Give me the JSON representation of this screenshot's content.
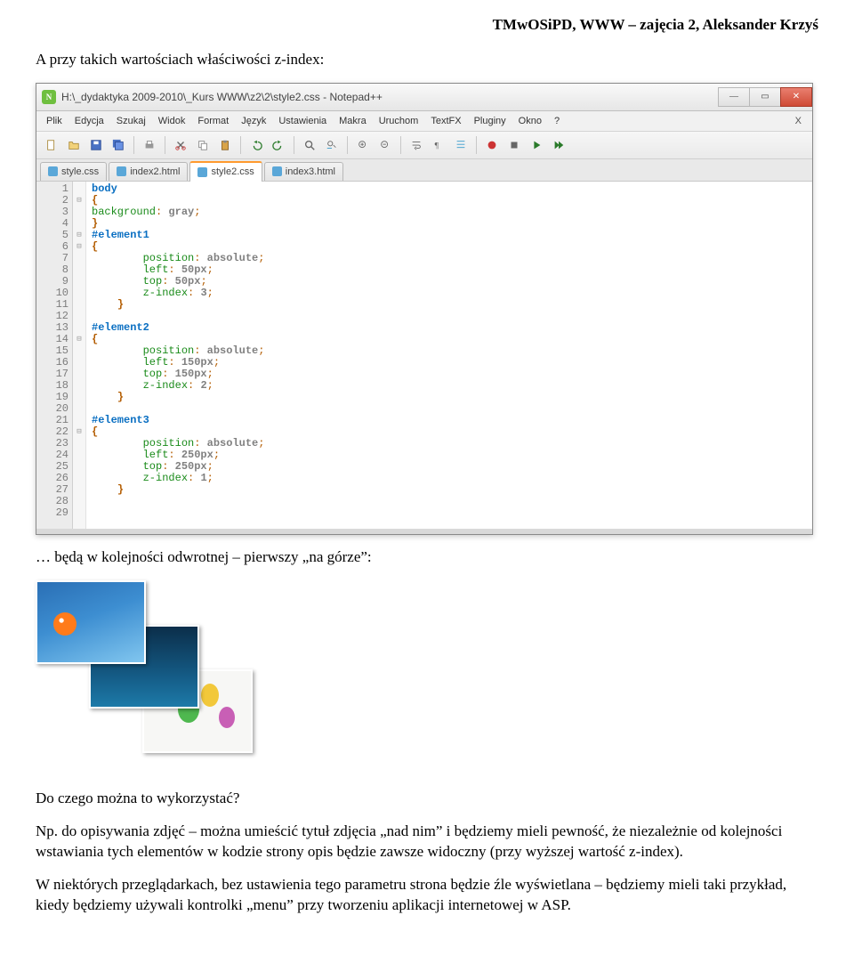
{
  "doc": {
    "header": "TMwOSiPD, WWW – zajęcia 2, Aleksander Krzyś",
    "intro": "A przy takich wartościach właściwości z-index:",
    "after_editor": "… będą w kolejności odwrotnej – pierwszy „na górze”:",
    "q": "Do czego można to wykorzystać?",
    "p1": "Np. do opisywania zdjęć – można umieścić tytuł zdjęcia „nad nim” i będziemy mieli pewność, że niezależnie od kolejności wstawiania tych elementów w kodzie strony opis będzie zawsze widoczny (przy wyższej wartość z-index).",
    "p2": "W niektórych przeglądarkach, bez ustawienia tego parametru strona będzie źle wyświetlana – będziemy mieli taki przykład, kiedy będziemy używali kontrolki „menu” przy tworzeniu aplikacji internetowej w ASP."
  },
  "win": {
    "title": "H:\\_dydaktyka 2009-2010\\_Kurs WWW\\z2\\2\\style2.css - Notepad++"
  },
  "menu": {
    "items": [
      "Plik",
      "Edycja",
      "Szukaj",
      "Widok",
      "Format",
      "Język",
      "Ustawienia",
      "Makra",
      "Uruchom",
      "TextFX",
      "Pluginy",
      "Okno",
      "?"
    ]
  },
  "tabs": [
    {
      "label": "style.css",
      "active": false
    },
    {
      "label": "index2.html",
      "active": false
    },
    {
      "label": "style2.css",
      "active": true
    },
    {
      "label": "index3.html",
      "active": false
    }
  ],
  "lines": [
    "1",
    "2",
    "3",
    "4",
    "5",
    "6",
    "7",
    "8",
    "9",
    "10",
    "11",
    "12",
    "13",
    "14",
    "15",
    "16",
    "17",
    "18",
    "19",
    "20",
    "21",
    "22",
    "23",
    "24",
    "25",
    "26",
    "27",
    "28",
    "29"
  ],
  "fold": [
    "",
    "⊟",
    "",
    "",
    "⊟",
    "⊟",
    "",
    "",
    "",
    "",
    "",
    "",
    "",
    "⊟",
    "",
    "",
    "",
    "",
    "",
    "",
    "",
    "⊟",
    "",
    "",
    "",
    "",
    "",
    "",
    ""
  ],
  "code": [
    {
      "t": "sel",
      "txt": "body"
    },
    {
      "t": "br",
      "txt": "{"
    },
    {
      "t": "line",
      "parts": [
        {
          "t": "prop",
          "txt": "background"
        },
        {
          "t": "op",
          "txt": ": "
        },
        {
          "t": "val",
          "txt": "gray"
        },
        {
          "t": "op",
          "txt": ";"
        }
      ]
    },
    {
      "t": "br",
      "txt": "}"
    },
    {
      "t": "sel",
      "txt": "#element1"
    },
    {
      "t": "br",
      "txt": "{"
    },
    {
      "t": "line",
      "indent": 2,
      "parts": [
        {
          "t": "prop",
          "txt": "position"
        },
        {
          "t": "op",
          "txt": ": "
        },
        {
          "t": "val",
          "txt": "absolute"
        },
        {
          "t": "op",
          "txt": ";"
        }
      ]
    },
    {
      "t": "line",
      "indent": 2,
      "parts": [
        {
          "t": "prop",
          "txt": "left"
        },
        {
          "t": "op",
          "txt": ": "
        },
        {
          "t": "val",
          "txt": "50px"
        },
        {
          "t": "op",
          "txt": ";"
        }
      ]
    },
    {
      "t": "line",
      "indent": 2,
      "parts": [
        {
          "t": "prop",
          "txt": "top"
        },
        {
          "t": "op",
          "txt": ": "
        },
        {
          "t": "val",
          "txt": "50px"
        },
        {
          "t": "op",
          "txt": ";"
        }
      ]
    },
    {
      "t": "line",
      "indent": 2,
      "parts": [
        {
          "t": "prop",
          "txt": "z-index"
        },
        {
          "t": "op",
          "txt": ": "
        },
        {
          "t": "val",
          "txt": "3"
        },
        {
          "t": "op",
          "txt": ";"
        }
      ]
    },
    {
      "t": "br",
      "indent": 1,
      "txt": "}"
    },
    {
      "t": "blank"
    },
    {
      "t": "sel",
      "txt": "#element2"
    },
    {
      "t": "br",
      "txt": "{"
    },
    {
      "t": "line",
      "indent": 2,
      "parts": [
        {
          "t": "prop",
          "txt": "position"
        },
        {
          "t": "op",
          "txt": ": "
        },
        {
          "t": "val",
          "txt": "absolute"
        },
        {
          "t": "op",
          "txt": ";"
        }
      ]
    },
    {
      "t": "line",
      "indent": 2,
      "parts": [
        {
          "t": "prop",
          "txt": "left"
        },
        {
          "t": "op",
          "txt": ": "
        },
        {
          "t": "val",
          "txt": "150px"
        },
        {
          "t": "op",
          "txt": ";"
        }
      ]
    },
    {
      "t": "line",
      "indent": 2,
      "parts": [
        {
          "t": "prop",
          "txt": "top"
        },
        {
          "t": "op",
          "txt": ": "
        },
        {
          "t": "val",
          "txt": "150px"
        },
        {
          "t": "op",
          "txt": ";"
        }
      ]
    },
    {
      "t": "line",
      "indent": 2,
      "parts": [
        {
          "t": "prop",
          "txt": "z-index"
        },
        {
          "t": "op",
          "txt": ": "
        },
        {
          "t": "val",
          "txt": "2"
        },
        {
          "t": "op",
          "txt": ";"
        }
      ]
    },
    {
      "t": "br",
      "indent": 1,
      "txt": "}"
    },
    {
      "t": "blank"
    },
    {
      "t": "sel",
      "txt": "#element3"
    },
    {
      "t": "br",
      "txt": "{"
    },
    {
      "t": "line",
      "indent": 2,
      "parts": [
        {
          "t": "prop",
          "txt": "position"
        },
        {
          "t": "op",
          "txt": ": "
        },
        {
          "t": "val",
          "txt": "absolute"
        },
        {
          "t": "op",
          "txt": ";"
        }
      ]
    },
    {
      "t": "line",
      "indent": 2,
      "parts": [
        {
          "t": "prop",
          "txt": "left"
        },
        {
          "t": "op",
          "txt": ": "
        },
        {
          "t": "val",
          "txt": "250px"
        },
        {
          "t": "op",
          "txt": ";"
        }
      ]
    },
    {
      "t": "line",
      "indent": 2,
      "parts": [
        {
          "t": "prop",
          "txt": "top"
        },
        {
          "t": "op",
          "txt": ": "
        },
        {
          "t": "val",
          "txt": "250px"
        },
        {
          "t": "op",
          "txt": ";"
        }
      ]
    },
    {
      "t": "line",
      "indent": 2,
      "parts": [
        {
          "t": "prop",
          "txt": "z-index"
        },
        {
          "t": "op",
          "txt": ": "
        },
        {
          "t": "val",
          "txt": "1"
        },
        {
          "t": "op",
          "txt": ";"
        }
      ]
    },
    {
      "t": "br",
      "indent": 1,
      "txt": "}"
    },
    {
      "t": "blank"
    },
    {
      "t": "blank"
    }
  ]
}
